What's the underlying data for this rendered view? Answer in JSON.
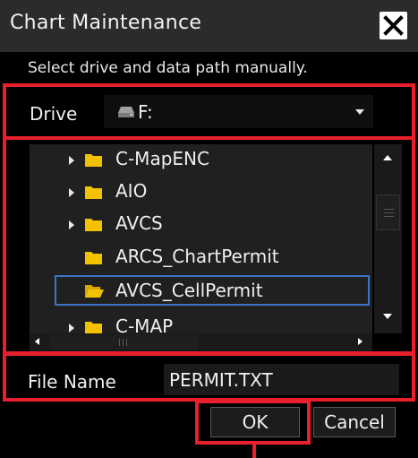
{
  "window": {
    "title": "Chart Maintenance",
    "close_icon": "close-icon"
  },
  "instruction": "Select drive and data path manually.",
  "drive": {
    "label": "Drive",
    "value": "F:",
    "icon": "drive-icon"
  },
  "tree": {
    "items": [
      {
        "label": "C-MapENC",
        "has_children": true,
        "selected": false
      },
      {
        "label": "AIO",
        "has_children": true,
        "selected": false
      },
      {
        "label": "AVCS",
        "has_children": true,
        "selected": false
      },
      {
        "label": "ARCS_ChartPermit",
        "has_children": false,
        "selected": false
      },
      {
        "label": "AVCS_CellPermit",
        "has_children": false,
        "selected": true
      },
      {
        "label": "C-MAP",
        "has_children": true,
        "selected": false
      }
    ]
  },
  "file_name": {
    "label": "File Name",
    "value": "PERMIT.TXT"
  },
  "buttons": {
    "ok": "OK",
    "cancel": "Cancel"
  },
  "colors": {
    "highlight": "#e8202c",
    "selection": "#3d73c6",
    "folder": "#f2c200",
    "background": "#000000"
  }
}
